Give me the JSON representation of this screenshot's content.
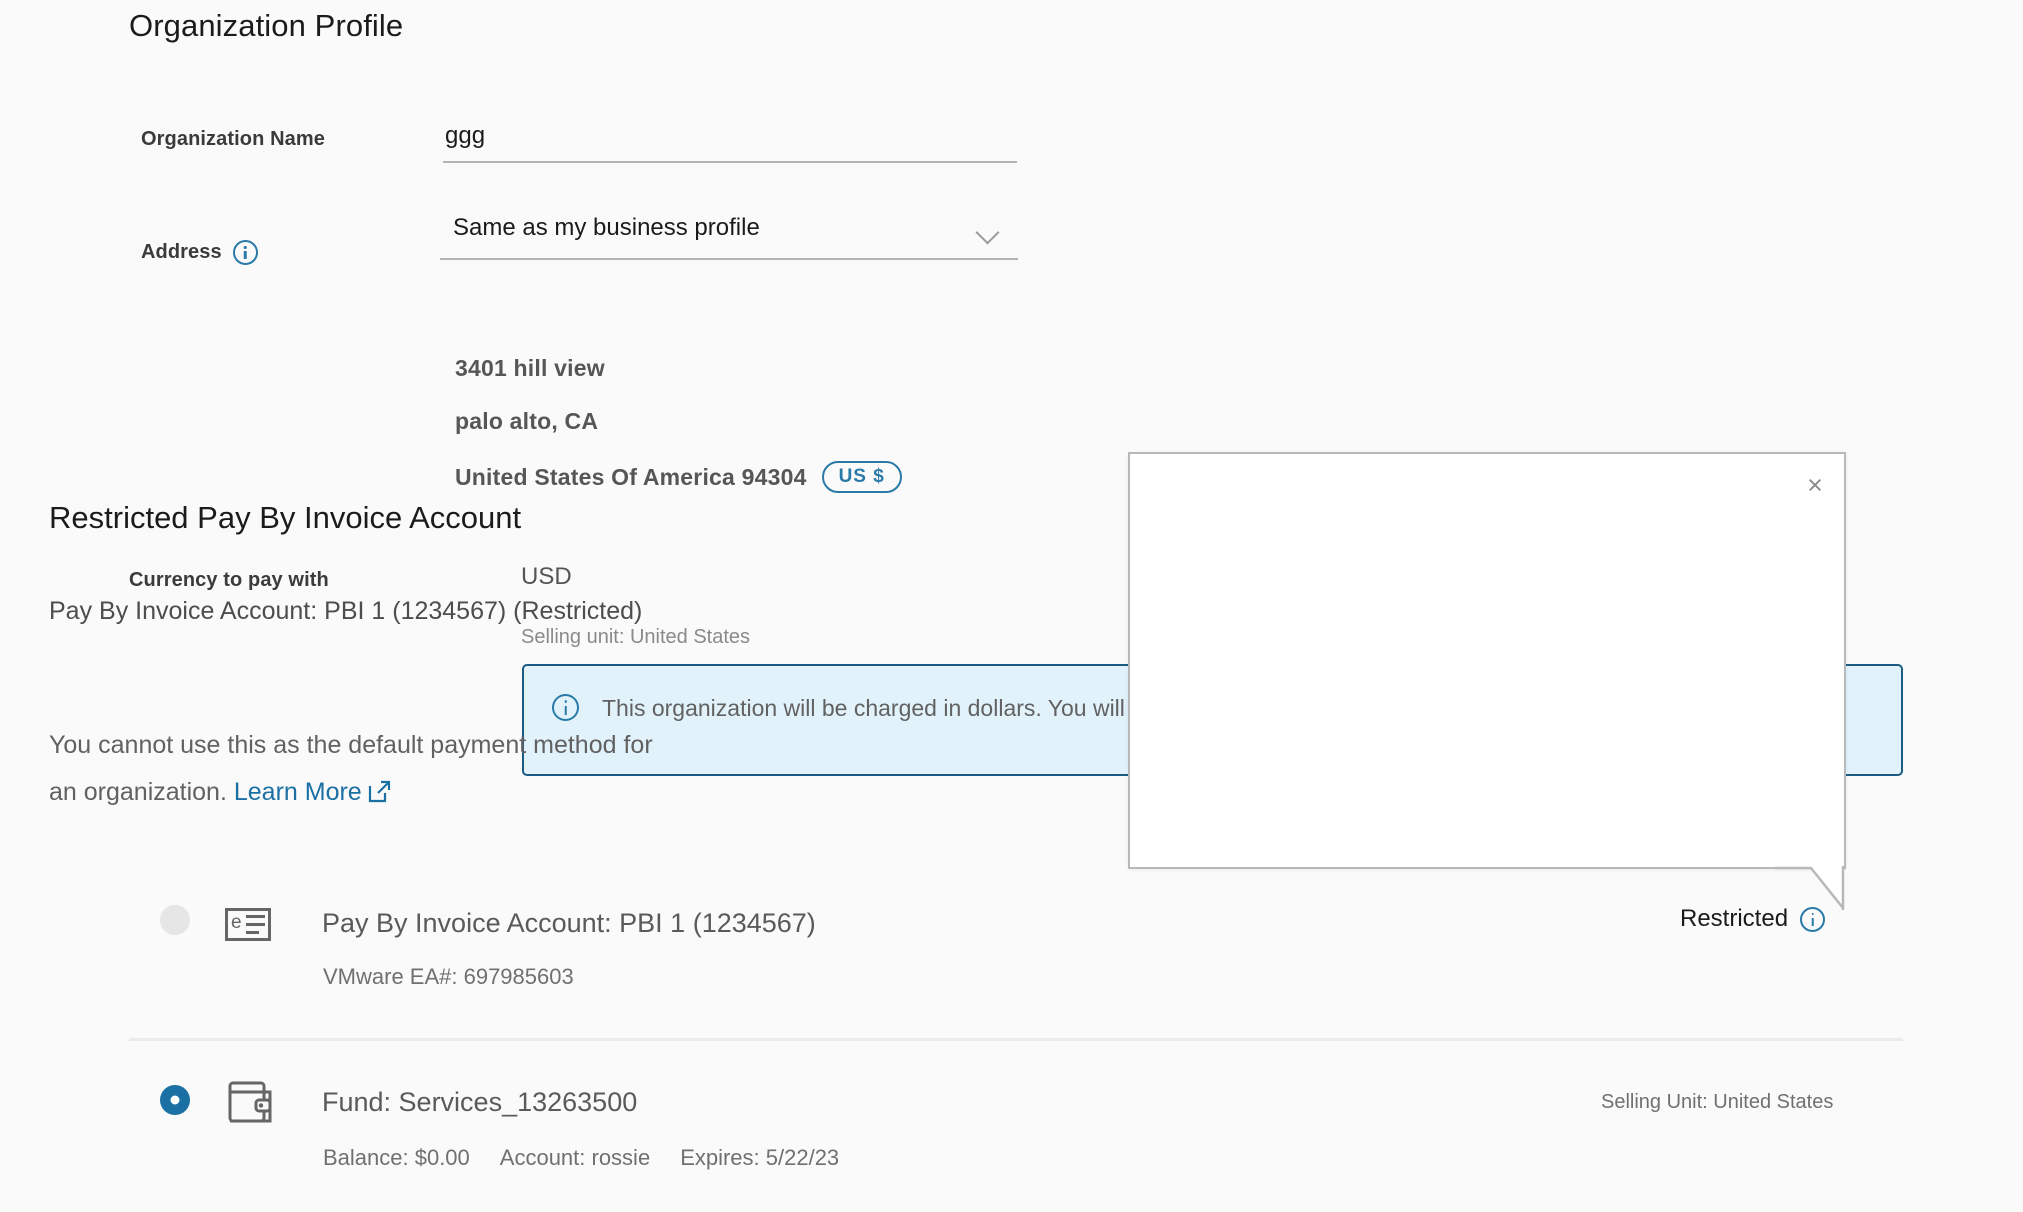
{
  "page": {
    "title": "Organization Profile"
  },
  "form": {
    "org_name": {
      "label": "Organization Name",
      "value": "ggg",
      "placeholder": "Organization Name"
    },
    "address": {
      "label": "Address",
      "info_icon": "info-icon",
      "selected_option": "Same as my business profile",
      "options": [
        "Same as my business profile"
      ],
      "chevron_icon": "chevron-down-icon",
      "lines": [
        "3401 hill view",
        "palo alto, CA",
        "United States Of America 94304"
      ],
      "currency_badge": "US $"
    },
    "currency": {
      "label": "Currency to pay with",
      "value": "USD",
      "selling_unit": "Selling unit: United States",
      "banner": {
        "icon": "info-icon",
        "text": "This organization will be charged in dollars. You will not be able to change the currency in the future."
      }
    }
  },
  "payment_methods": [
    {
      "radio_state": "disabled",
      "icon": "e-invoice-icon",
      "title": "Pay By Invoice Account: PBI 1 (1234567)",
      "subtitle": "VMware EA#: 697985603",
      "right_label": "Restricted",
      "right_icon": "info-icon"
    },
    {
      "radio_state": "selected",
      "icon": "wallet-icon",
      "title": "Fund: Services_13263500",
      "sub_balance": "Balance: $0.00",
      "sub_account": "Account: rossie",
      "sub_expires": "Expires: 5/22/23",
      "right_label": "Selling Unit: United States"
    }
  ],
  "popover": {
    "title": "Restricted Pay By Invoice Account",
    "body_line_1": "Pay By Invoice Account: PBI 1 (1234567) (Restricted)",
    "body_line_2": "You cannot use this as the default payment method for an organization.",
    "link_label": "Learn More",
    "link_icon": "external-link-icon",
    "close_icon": "×"
  },
  "colors": {
    "background": "#fafafa",
    "accent_blue": "#2a7aa8",
    "link_blue": "#1a6fa3",
    "banner_bg": "#e2f2fb",
    "banner_border": "#1d5c82",
    "radio_selected": "#1a6fa3",
    "radio_disabled": "#e6e6e6",
    "divider": "#ebebeb"
  }
}
